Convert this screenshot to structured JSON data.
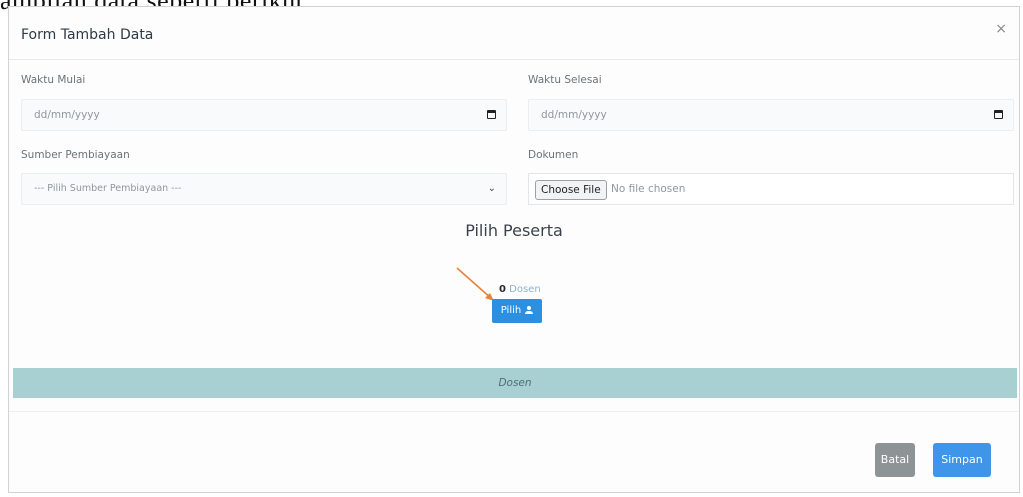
{
  "caption": "ambilan data seperti berikut.",
  "modal": {
    "title": "Form Tambah Data",
    "close_label": "×"
  },
  "form": {
    "waktu_mulai": {
      "label": "Waktu Mulai",
      "placeholder": "dd/mm/yyyy"
    },
    "waktu_selesai": {
      "label": "Waktu Selesai",
      "placeholder": "dd/mm/yyyy"
    },
    "sumber_pembiayaan": {
      "label": "Sumber Pembiayaan",
      "selected": "--- Pilih Sumber Pembiayaan ---"
    },
    "dokumen": {
      "label": "Dokumen",
      "button_label": "Choose File",
      "status": "No file chosen"
    }
  },
  "peserta": {
    "title": "Pilih Peserta",
    "count": "0",
    "count_unit": "Dosen",
    "pilih_label": "Pilih"
  },
  "table": {
    "header": "Dosen"
  },
  "footer": {
    "batal_label": "Batal",
    "simpan_label": "Simpan"
  },
  "colors": {
    "primary": "#2d8fe0",
    "table_header": "#a8cfd2",
    "batal": "#8e9396",
    "arrow": "#e8823a"
  }
}
